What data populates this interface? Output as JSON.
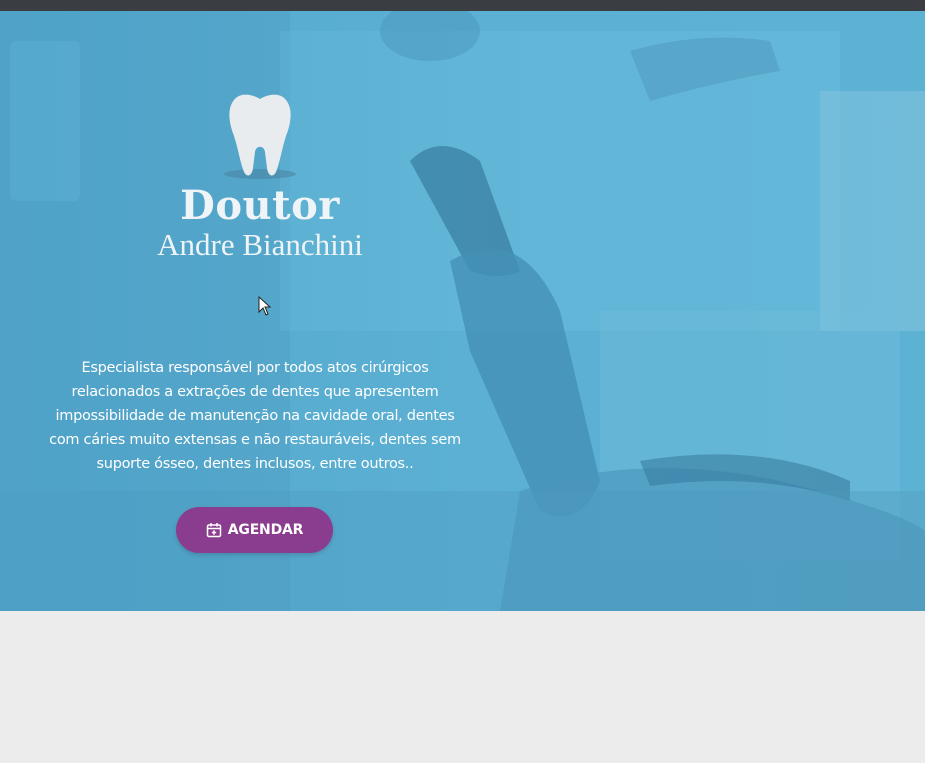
{
  "brand": {
    "line1": "Doutor",
    "line2": "Andre Bianchini",
    "logo_icon": "tooth-icon"
  },
  "hero": {
    "description": "Especialista responsável por todos atos cirúrgicos relacionados a extrações de dentes que apresentem impossibilidade de manutenção na cavidade oral, dentes com cáries muito extensas e não restauráveis, dentes sem suporte ósseo, dentes inclusos, entre outros..",
    "cta_label": "AGENDAR",
    "cta_icon": "calendar-plus-icon"
  },
  "colors": {
    "hero_tint": "#5fb3d4",
    "cta_background": "#8a3d8e",
    "top_bar": "#3a3d42",
    "page_background": "#ececec"
  }
}
